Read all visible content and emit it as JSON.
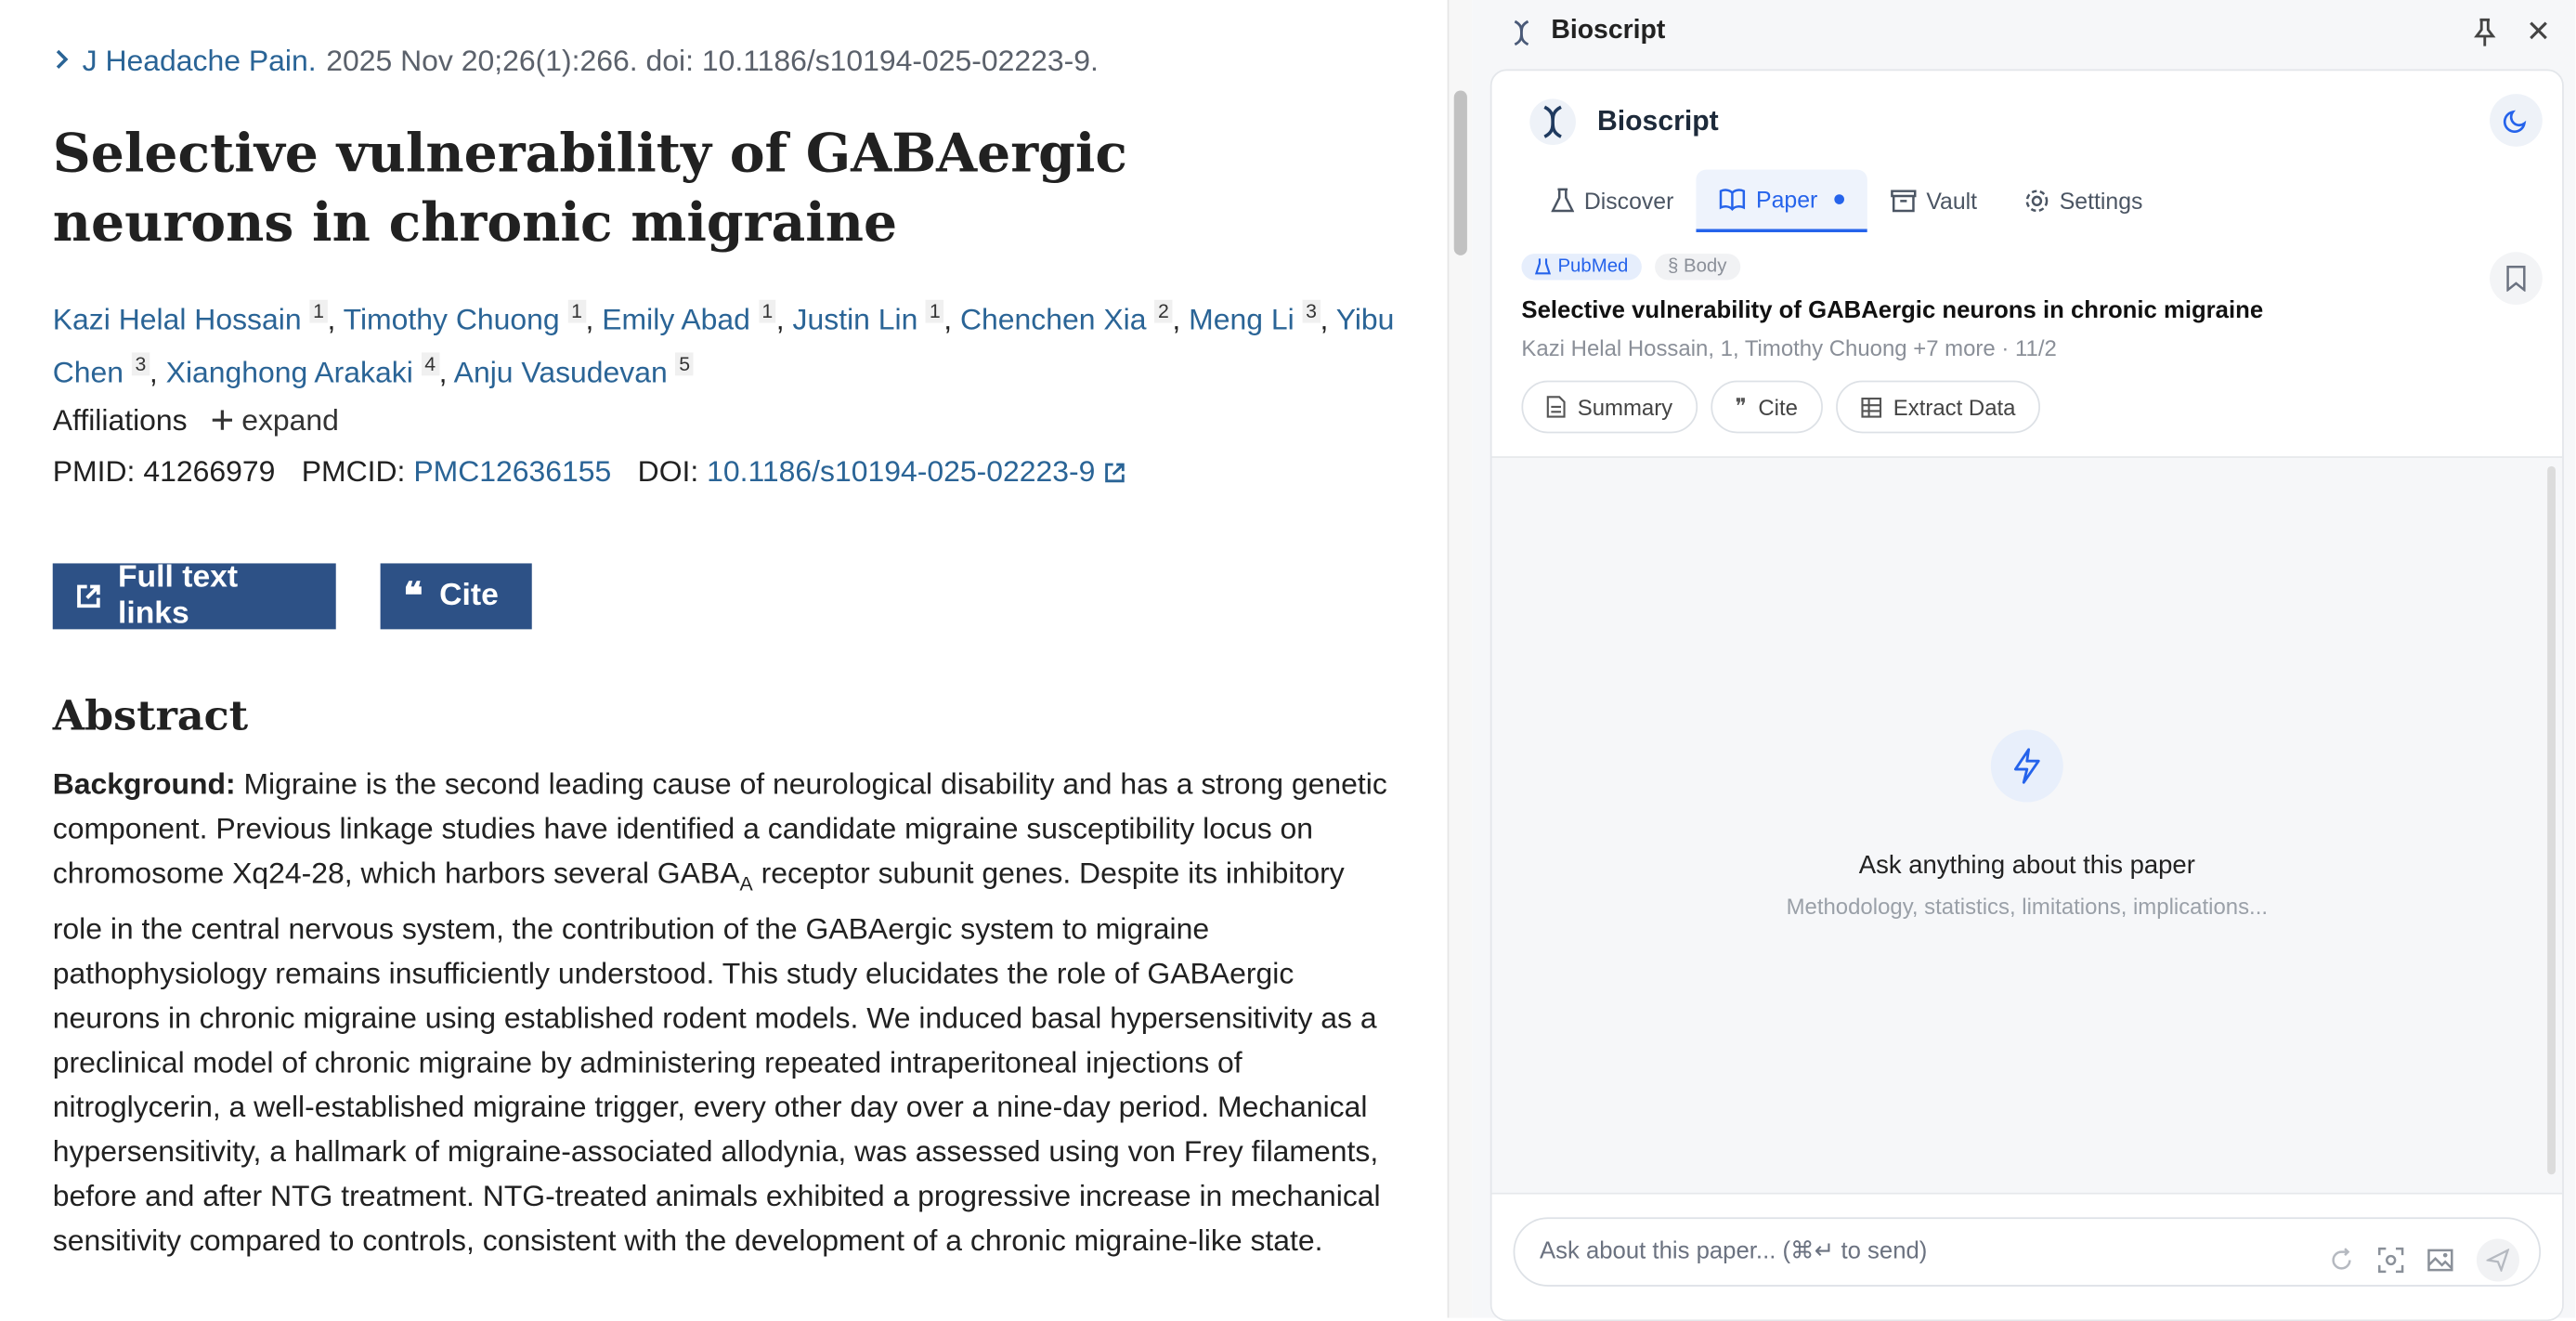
{
  "article": {
    "journal": "J Headache Pain.",
    "citation": "2025 Nov 20;26(1):266. doi: 10.1186/s10194-025-02223-9.",
    "title": "Selective vulnerability of GABAergic neurons in chronic migraine",
    "authors": [
      {
        "name": "Kazi Helal Hossain",
        "aff": "1"
      },
      {
        "name": "Timothy Chuong",
        "aff": "1"
      },
      {
        "name": "Emily Abad",
        "aff": "1"
      },
      {
        "name": "Justin Lin",
        "aff": "1"
      },
      {
        "name": "Chenchen Xia",
        "aff": "2"
      },
      {
        "name": "Meng Li",
        "aff": "3"
      },
      {
        "name": "Yibu Chen",
        "aff": "3"
      },
      {
        "name": "Xianghong Arakaki",
        "aff": "4"
      },
      {
        "name": "Anju Vasudevan",
        "aff": "5"
      }
    ],
    "affiliations_label": "Affiliations",
    "expand_label": "expand",
    "pmid_label": "PMID:",
    "pmid": "41266979",
    "pmcid_label": "PMCID:",
    "pmcid": "PMC12636155",
    "doi_label": "DOI:",
    "doi": "10.1186/s10194-025-02223-9",
    "full_text_button": "Full text links",
    "cite_button": "Cite",
    "abstract_heading": "Abstract",
    "abstract_label": "Background:",
    "abstract_p1": " Migraine is the second leading cause of neurological disability and has a strong genetic component. Previous linkage studies have identified a candidate migraine susceptibility locus on chromosome Xq24-28, which harbors several GABA",
    "abstract_sub": "A",
    "abstract_p2": " receptor subunit genes. Despite its inhibitory role in the central nervous system, the contribution of the GABAergic system to migraine pathophysiology remains insufficiently understood. This study elucidates the role of GABAergic neurons in chronic migraine using established rodent models. We induced basal hypersensitivity as a preclinical model of chronic migraine by administering repeated intraperitoneal injections of nitroglycerin, a well-established migraine trigger, every other day over a nine-day period. Mechanical hypersensitivity, a hallmark of migraine-associated allodynia, was assessed using von Frey filaments, before and after NTG treatment. NTG-treated animals exhibited a progressive increase in mechanical sensitivity compared to controls, consistent with the development of a chronic migraine-like state."
  },
  "panel": {
    "window_title": "Bioscript",
    "brand": "Bioscript",
    "tabs": [
      {
        "label": "Discover"
      },
      {
        "label": "Paper"
      },
      {
        "label": "Vault"
      },
      {
        "label": "Settings"
      }
    ],
    "badge_source": "PubMed",
    "badge_section": "§ Body",
    "paper_title": "Selective vulnerability of GABAergic neurons in chronic migraine",
    "paper_meta": "Kazi Helal Hossain, 1, Timothy Chuong +7 more · 11/2",
    "actions": [
      {
        "label": "Summary"
      },
      {
        "label": "Cite"
      },
      {
        "label": "Extract Data"
      }
    ],
    "empty_title": "Ask anything about this paper",
    "empty_sub": "Methodology, statistics, limitations, implications...",
    "input_placeholder": "Ask about this paper... (⌘↵ to send)"
  },
  "colors": {
    "link": "#2a6496",
    "button_bg": "#2d5186",
    "accent": "#2563eb"
  }
}
